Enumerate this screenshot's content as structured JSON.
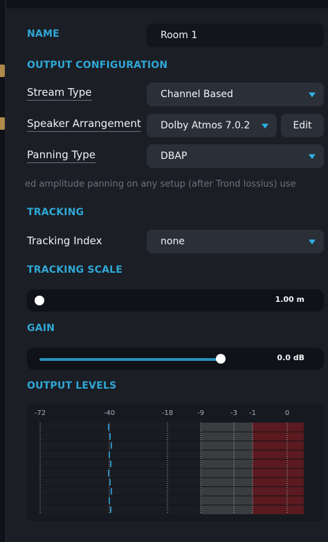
{
  "name": {
    "label": "NAME",
    "value": "Room 1"
  },
  "output_configuration": {
    "title": "OUTPUT CONFIGURATION",
    "stream_type": {
      "label": "Stream Type",
      "value": "Channel Based"
    },
    "speaker_arrangement": {
      "label": "Speaker Arrangement",
      "value": "Dolby Atmos 7.0.2",
      "edit_label": "Edit"
    },
    "panning_type": {
      "label": "Panning Type",
      "value": "DBAP"
    },
    "description": "ed amplitude panning on any setup (after Trond lossius) use"
  },
  "tracking": {
    "title": "TRACKING",
    "index": {
      "label": "Tracking Index",
      "value": "none"
    }
  },
  "tracking_scale": {
    "title": "TRACKING SCALE",
    "value_text": "1.00 m",
    "slider_fraction": 0.0
  },
  "gain": {
    "title": "GAIN",
    "value_text": "0.0 dB",
    "slider_fraction": 0.75
  },
  "output_levels": {
    "title": "OUTPUT LEVELS",
    "scale": [
      "-72",
      "-40",
      "-18",
      "-9",
      "-3",
      "-1",
      "0"
    ],
    "channel_count": 10,
    "peak_db": [
      -40,
      -40,
      -40,
      -40,
      -40,
      -40,
      -40,
      -40,
      -40,
      -40
    ],
    "colors": {
      "low": "#1a1c21",
      "mid": "#3a3c40",
      "high": "#5a1a1f",
      "level_bar": "#2a8fc0"
    }
  },
  "icons": {
    "dropdown": "chevron-down-icon",
    "slider_thumb": "slider-thumb-icon"
  },
  "colors": {
    "accent": "#2fa8d6",
    "background": "#1b1e25",
    "field": "#12151b",
    "button": "#2a2f38"
  }
}
